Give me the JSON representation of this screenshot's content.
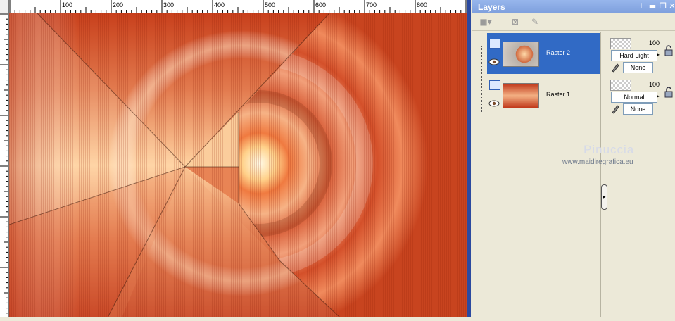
{
  "ruler": {
    "top_labels": [
      "100",
      "200",
      "300",
      "400",
      "500",
      "600",
      "700",
      "800"
    ]
  },
  "palette": {
    "title": "Layers",
    "title_buttons": {
      "pin": "📌",
      "minimize": "—",
      "restore": "▣",
      "close": "✕"
    },
    "layers": [
      {
        "name": "Raster 2",
        "selected": true,
        "opacity": "100",
        "blend_mode": "Hard Light",
        "mask": "None"
      },
      {
        "name": "Raster 1",
        "selected": false,
        "opacity": "100",
        "blend_mode": "Normal",
        "mask": "None"
      }
    ]
  },
  "watermark": {
    "name": "Pinuccia",
    "url": "www.maidiregrafica.eu"
  },
  "colors": {
    "selection": "#316ac5",
    "title_bar": "#7e9fdd",
    "canvas_primary": "#c8401c",
    "canvas_light": "#ffd9a8"
  }
}
